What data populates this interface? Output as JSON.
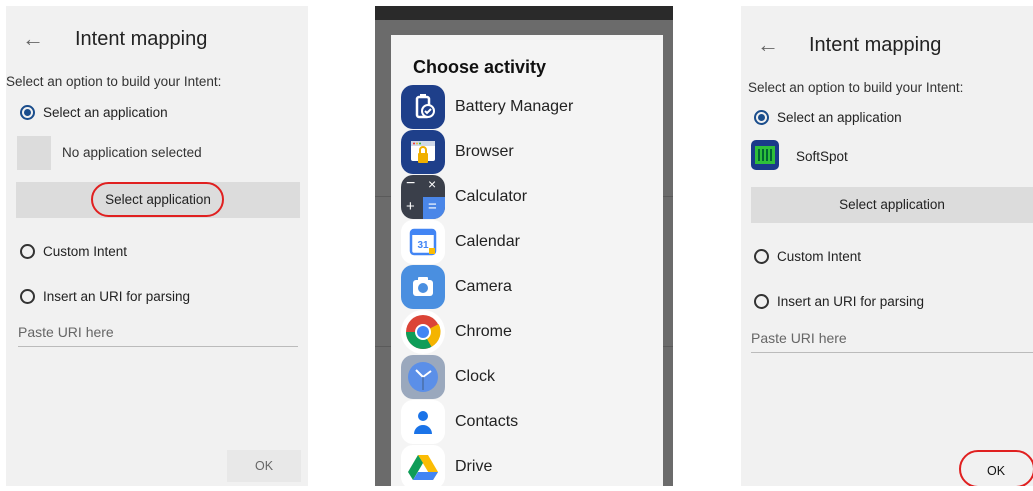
{
  "left_screen": {
    "title": "Intent mapping",
    "back_glyph": "←",
    "prompt": "Select an option to build your Intent:",
    "option_app": "Select an application",
    "no_app": "No application selected",
    "select_btn": "Select application",
    "option_custom": "Custom Intent",
    "option_uri": "Insert an URI for parsing",
    "uri_placeholder": "Paste URI here",
    "ok": "OK"
  },
  "dialog": {
    "title": "Choose activity",
    "apps": [
      {
        "label": "Battery Manager",
        "icon": "battery-manager-icon"
      },
      {
        "label": "Browser",
        "icon": "browser-icon"
      },
      {
        "label": "Calculator",
        "icon": "calculator-icon"
      },
      {
        "label": "Calendar",
        "icon": "calendar-icon"
      },
      {
        "label": "Camera",
        "icon": "camera-icon"
      },
      {
        "label": "Chrome",
        "icon": "chrome-icon"
      },
      {
        "label": "Clock",
        "icon": "clock-icon"
      },
      {
        "label": "Contacts",
        "icon": "contacts-icon"
      },
      {
        "label": "Drive",
        "icon": "drive-icon"
      }
    ]
  },
  "right_screen": {
    "title": "Intent mapping",
    "back_glyph": "←",
    "prompt": "Select an option to build your Intent:",
    "option_app": "Select an application",
    "selected_app": "SoftSpot",
    "select_btn": "Select application",
    "option_custom": "Custom Intent",
    "option_uri": "Insert an URI for parsing",
    "uri_placeholder": "Paste URI here",
    "ok": "OK"
  },
  "colors": {
    "accent": "#1a4d8c",
    "callout": "#e02020"
  }
}
